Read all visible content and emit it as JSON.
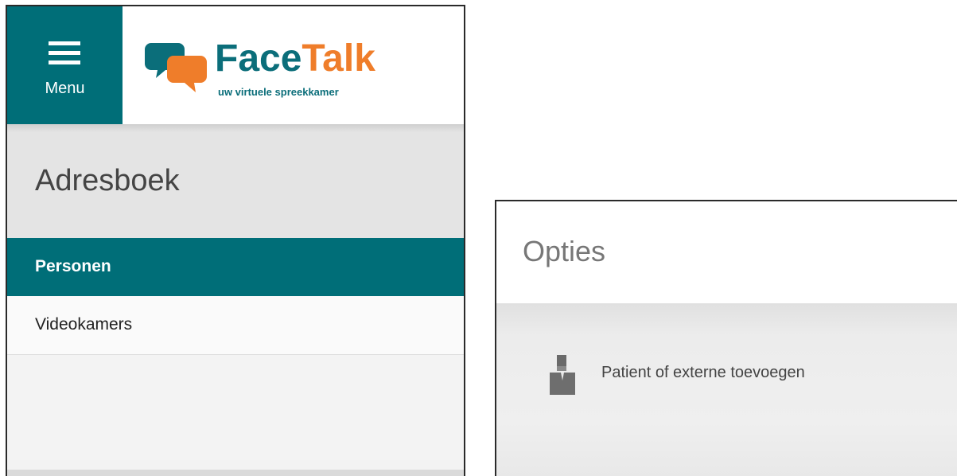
{
  "header": {
    "menu_label": "Menu",
    "logo": {
      "name_part1": "Face",
      "name_part2": "Talk",
      "tagline": "uw virtuele spreekkamer"
    }
  },
  "sidebar": {
    "title": "Adresboek",
    "items": [
      {
        "label": "Personen",
        "active": true
      },
      {
        "label": "Videokamers",
        "active": false
      }
    ]
  },
  "options_panel": {
    "title": "Opties",
    "items": [
      {
        "label": "Patient of externe toevoegen",
        "icon": "person-icon"
      }
    ]
  },
  "colors": {
    "brand_teal": "#006e78",
    "brand_orange": "#ef7d2a"
  }
}
